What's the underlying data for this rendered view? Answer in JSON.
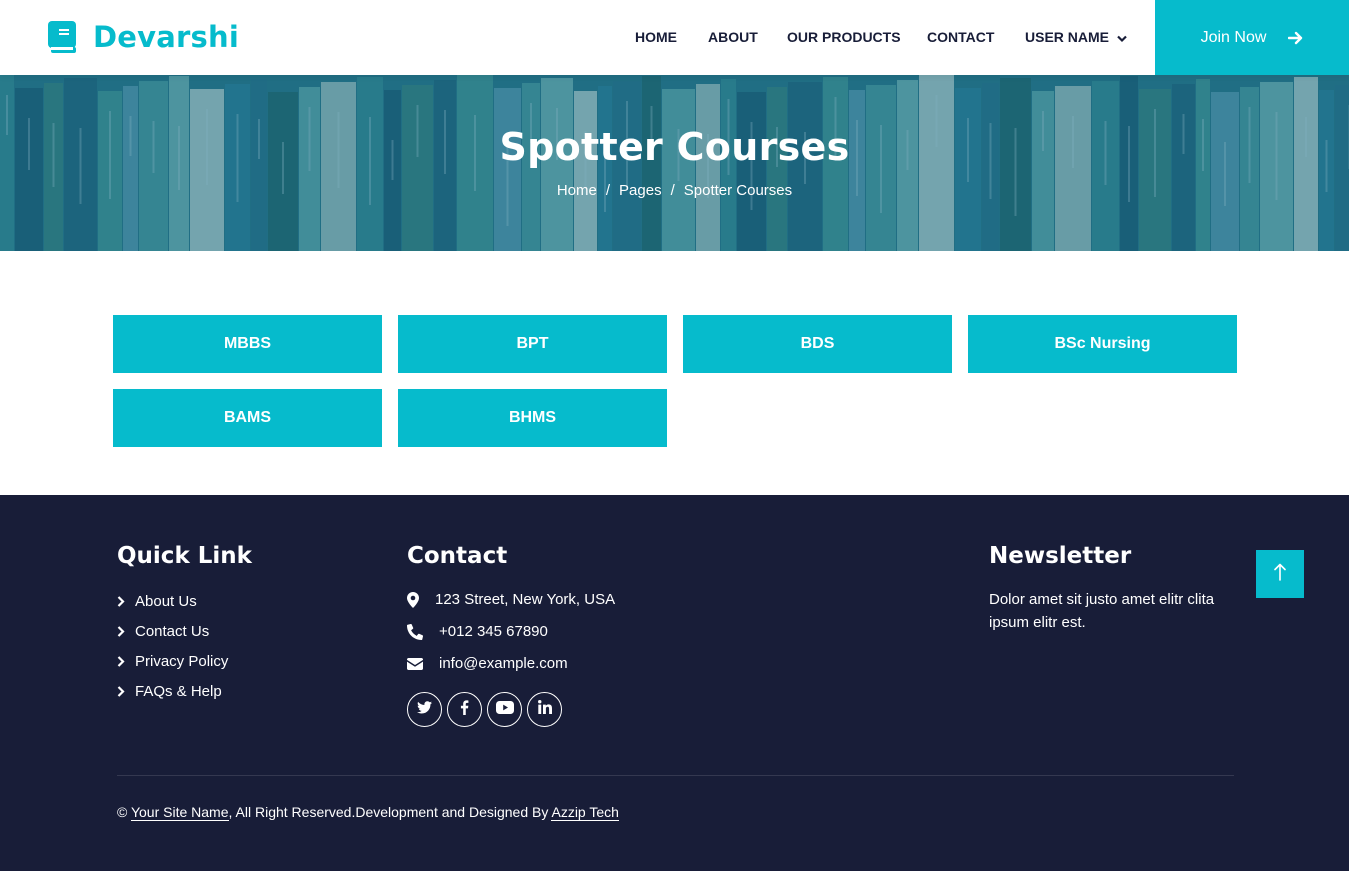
{
  "brand": {
    "name": "Devarshi"
  },
  "nav": {
    "items": [
      "HOME",
      "ABOUT",
      "OUR PRODUCTS",
      "CONTACT",
      "USER NAME"
    ],
    "join_label": "Join Now"
  },
  "hero": {
    "title": "Spotter Courses",
    "breadcrumb": [
      "Home",
      "Pages",
      "Spotter Courses"
    ],
    "separator": "/"
  },
  "courses": [
    "MBBS",
    "BPT",
    "BDS",
    "BSc Nursing",
    "BAMS",
    "BHMS"
  ],
  "footer": {
    "quick_link": {
      "heading": "Quick Link",
      "items": [
        "About Us",
        "Contact Us",
        "Privacy Policy",
        "FAQs & Help"
      ]
    },
    "contact": {
      "heading": "Contact",
      "address": "123 Street, New York, USA",
      "phone": "+012 345 67890",
      "email": "info@example.com",
      "social": [
        "twitter-icon",
        "facebook-icon",
        "youtube-icon",
        "linkedin-icon"
      ]
    },
    "newsletter": {
      "heading": "Newsletter",
      "text": "Dolor amet sit justo amet elitr clita ipsum elitr est."
    },
    "copyright": {
      "symbol": "©",
      "site_name": "Your Site Name",
      "middle": ", All Right Reserved.Development and Designed By",
      "designer": "Azzip Tech"
    }
  },
  "colors": {
    "accent": "#06bbcc",
    "dark": "#181d38",
    "white": "#ffffff"
  }
}
